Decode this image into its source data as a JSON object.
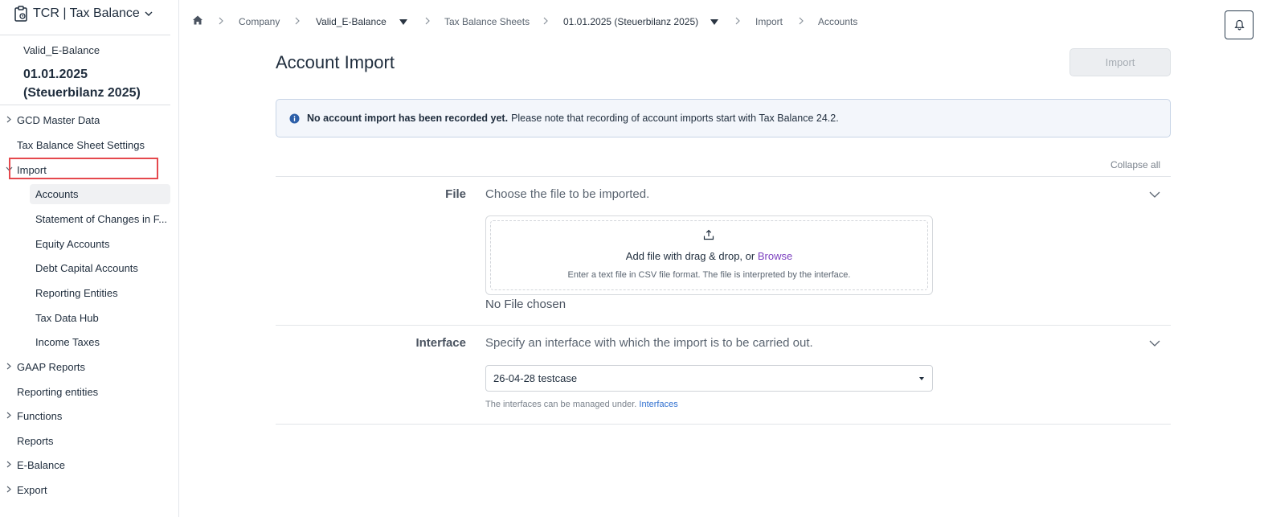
{
  "app": {
    "title": "TCR | Tax Balance"
  },
  "context": {
    "company": "Valid_E-Balance",
    "period": "01.01.2025 (Steuerbilanz 2025)"
  },
  "sidebar": {
    "items": [
      {
        "label": "GCD Master Data",
        "expandable": true
      },
      {
        "label": "Tax Balance Sheet Settings",
        "expandable": false
      },
      {
        "label": "Import",
        "expandable": true,
        "expanded": true
      },
      {
        "label": "GAAP Reports",
        "expandable": true
      },
      {
        "label": "Reporting entities",
        "expandable": false
      },
      {
        "label": "Functions",
        "expandable": true
      },
      {
        "label": "Reports",
        "expandable": false
      },
      {
        "label": "E-Balance",
        "expandable": true
      },
      {
        "label": "Export",
        "expandable": true
      }
    ],
    "import_children": [
      {
        "label": "Accounts",
        "active": true
      },
      {
        "label": "Statement of Changes in F..."
      },
      {
        "label": "Equity Accounts"
      },
      {
        "label": "Debt Capital Accounts"
      },
      {
        "label": "Reporting Entities"
      },
      {
        "label": "Tax Data Hub"
      },
      {
        "label": "Income Taxes"
      }
    ]
  },
  "breadcrumb": {
    "items": [
      "Company",
      "Valid_E-Balance",
      "Tax Balance Sheets",
      "01.01.2025 (Steuerbilanz 2025)",
      "Import",
      "Accounts"
    ]
  },
  "main": {
    "title": "Account Import",
    "import_button": "Import",
    "info": {
      "bold": "No account import has been recorded yet.",
      "text": "Please note that recording of account imports start with Tax Balance 24.2."
    },
    "collapse_all": "Collapse all",
    "file_section": {
      "label": "File",
      "description": "Choose the file to be imported.",
      "drop_text": "Add file with drag & drop, or",
      "browse": "Browse",
      "hint": "Enter a text file in CSV file format. The file is interpreted by the interface.",
      "no_file": "No File chosen"
    },
    "interface_section": {
      "label": "Interface",
      "description": "Specify an interface with which the import is to be carried out.",
      "selected": "26-04-28 testcase",
      "helper_text": "The interfaces can be managed under.",
      "helper_link": "Interfaces"
    }
  },
  "colors": {
    "accent_link": "#2f6fcf",
    "browse_link": "#7b3fbf",
    "highlight": "#e5484d",
    "info_icon": "#2d5fa8"
  }
}
